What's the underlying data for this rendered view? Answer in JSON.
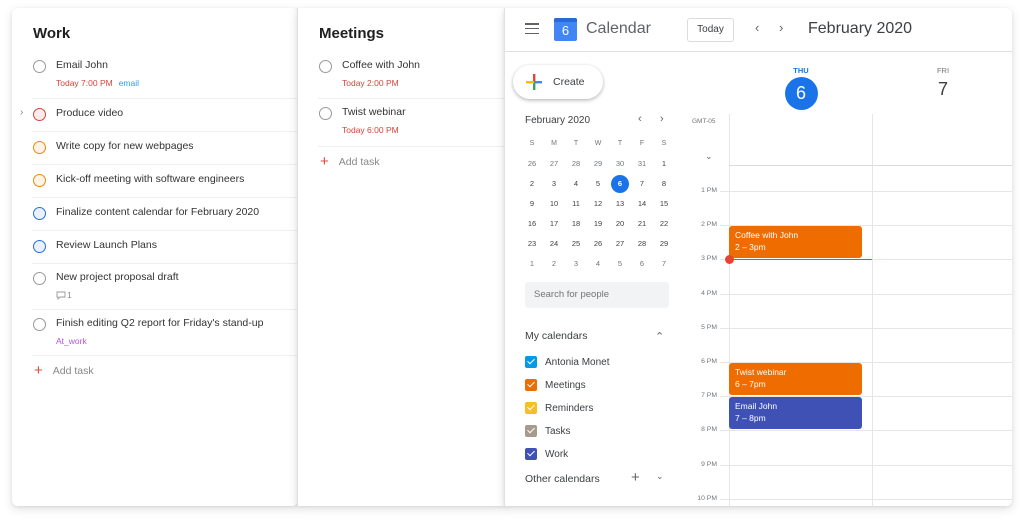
{
  "work": {
    "title": "Work",
    "tasks": [
      {
        "name": "Email John",
        "due": "Today 7:00 PM",
        "label": "email",
        "priority": "none"
      },
      {
        "name": "Produce video",
        "priority": "p1",
        "expandable": true
      },
      {
        "name": "Write copy for new webpages",
        "priority": "p2"
      },
      {
        "name": "Kick-off meeting with software engineers",
        "priority": "p2"
      },
      {
        "name": "Finalize content calendar for February 2020",
        "priority": "p3"
      },
      {
        "name": "Review Launch Plans",
        "priority": "p3"
      },
      {
        "name": "New project proposal draft",
        "comments": "1",
        "priority": "none"
      },
      {
        "name": "Finish editing Q2 report for Friday's stand-up",
        "label": "At_work",
        "priority": "none"
      }
    ],
    "add_task": "Add task"
  },
  "meetings": {
    "title": "Meetings",
    "tasks": [
      {
        "name": "Coffee with John",
        "due": "Today 2:00 PM"
      },
      {
        "name": "Twist webinar",
        "due": "Today 6:00 PM"
      }
    ],
    "add_task": "Add task"
  },
  "calendar": {
    "app_title": "Calendar",
    "logo_day": "6",
    "today_button": "Today",
    "prev_icon": "‹",
    "next_icon": "›",
    "current_period": "February 2020",
    "create_label": "Create",
    "mini_cal": {
      "title": "February 2020",
      "weekdays": [
        "S",
        "M",
        "T",
        "W",
        "T",
        "F",
        "S"
      ],
      "weeks": [
        [
          "26",
          "27",
          "28",
          "29",
          "30",
          "31",
          "1"
        ],
        [
          "2",
          "3",
          "4",
          "5",
          "6",
          "7",
          "8"
        ],
        [
          "9",
          "10",
          "11",
          "12",
          "13",
          "14",
          "15"
        ],
        [
          "16",
          "17",
          "18",
          "19",
          "20",
          "21",
          "22"
        ],
        [
          "23",
          "24",
          "25",
          "26",
          "27",
          "28",
          "29"
        ],
        [
          "1",
          "2",
          "3",
          "4",
          "5",
          "6",
          "7"
        ]
      ],
      "selected": "6"
    },
    "search_people_placeholder": "Search for people",
    "my_calendars_title": "My calendars",
    "my_calendars": [
      {
        "name": "Antonia Monet",
        "color": "#039be5",
        "checked": true
      },
      {
        "name": "Meetings",
        "color": "#ef6c00",
        "checked": true
      },
      {
        "name": "Reminders",
        "color": "#f6bf26",
        "checked": true
      },
      {
        "name": "Tasks",
        "color": "#a79b8e",
        "checked": true
      },
      {
        "name": "Work",
        "color": "#3f51b5",
        "checked": true
      }
    ],
    "other_calendars_title": "Other calendars",
    "timezone": "GMT-05",
    "days": [
      {
        "dow": "THU",
        "num": "6",
        "is_today": true
      },
      {
        "dow": "FRI",
        "num": "7",
        "is_today": false
      }
    ],
    "hours": [
      "1 PM",
      "2 PM",
      "3 PM",
      "4 PM",
      "5 PM",
      "6 PM",
      "7 PM",
      "8 PM",
      "9 PM",
      "10 PM"
    ],
    "events": [
      {
        "title": "Coffee with John",
        "time": "2 – 3pm",
        "start": 14,
        "end": 15,
        "color": "#ef6c00",
        "day": 0
      },
      {
        "title": "Twist webinar",
        "time": "6 – 7pm",
        "start": 18,
        "end": 19,
        "color": "#ef6c00",
        "day": 0
      },
      {
        "title": "Email John",
        "time": "7 – 8pm",
        "start": 19,
        "end": 20,
        "color": "#3f51b5",
        "day": 0
      }
    ],
    "now_hour": 15.0
  },
  "colors": {
    "p1": "#d1453b",
    "p2": "#eb8909",
    "p3": "#246fe0",
    "due": "#d1453b",
    "accent": "#1a73e8"
  }
}
